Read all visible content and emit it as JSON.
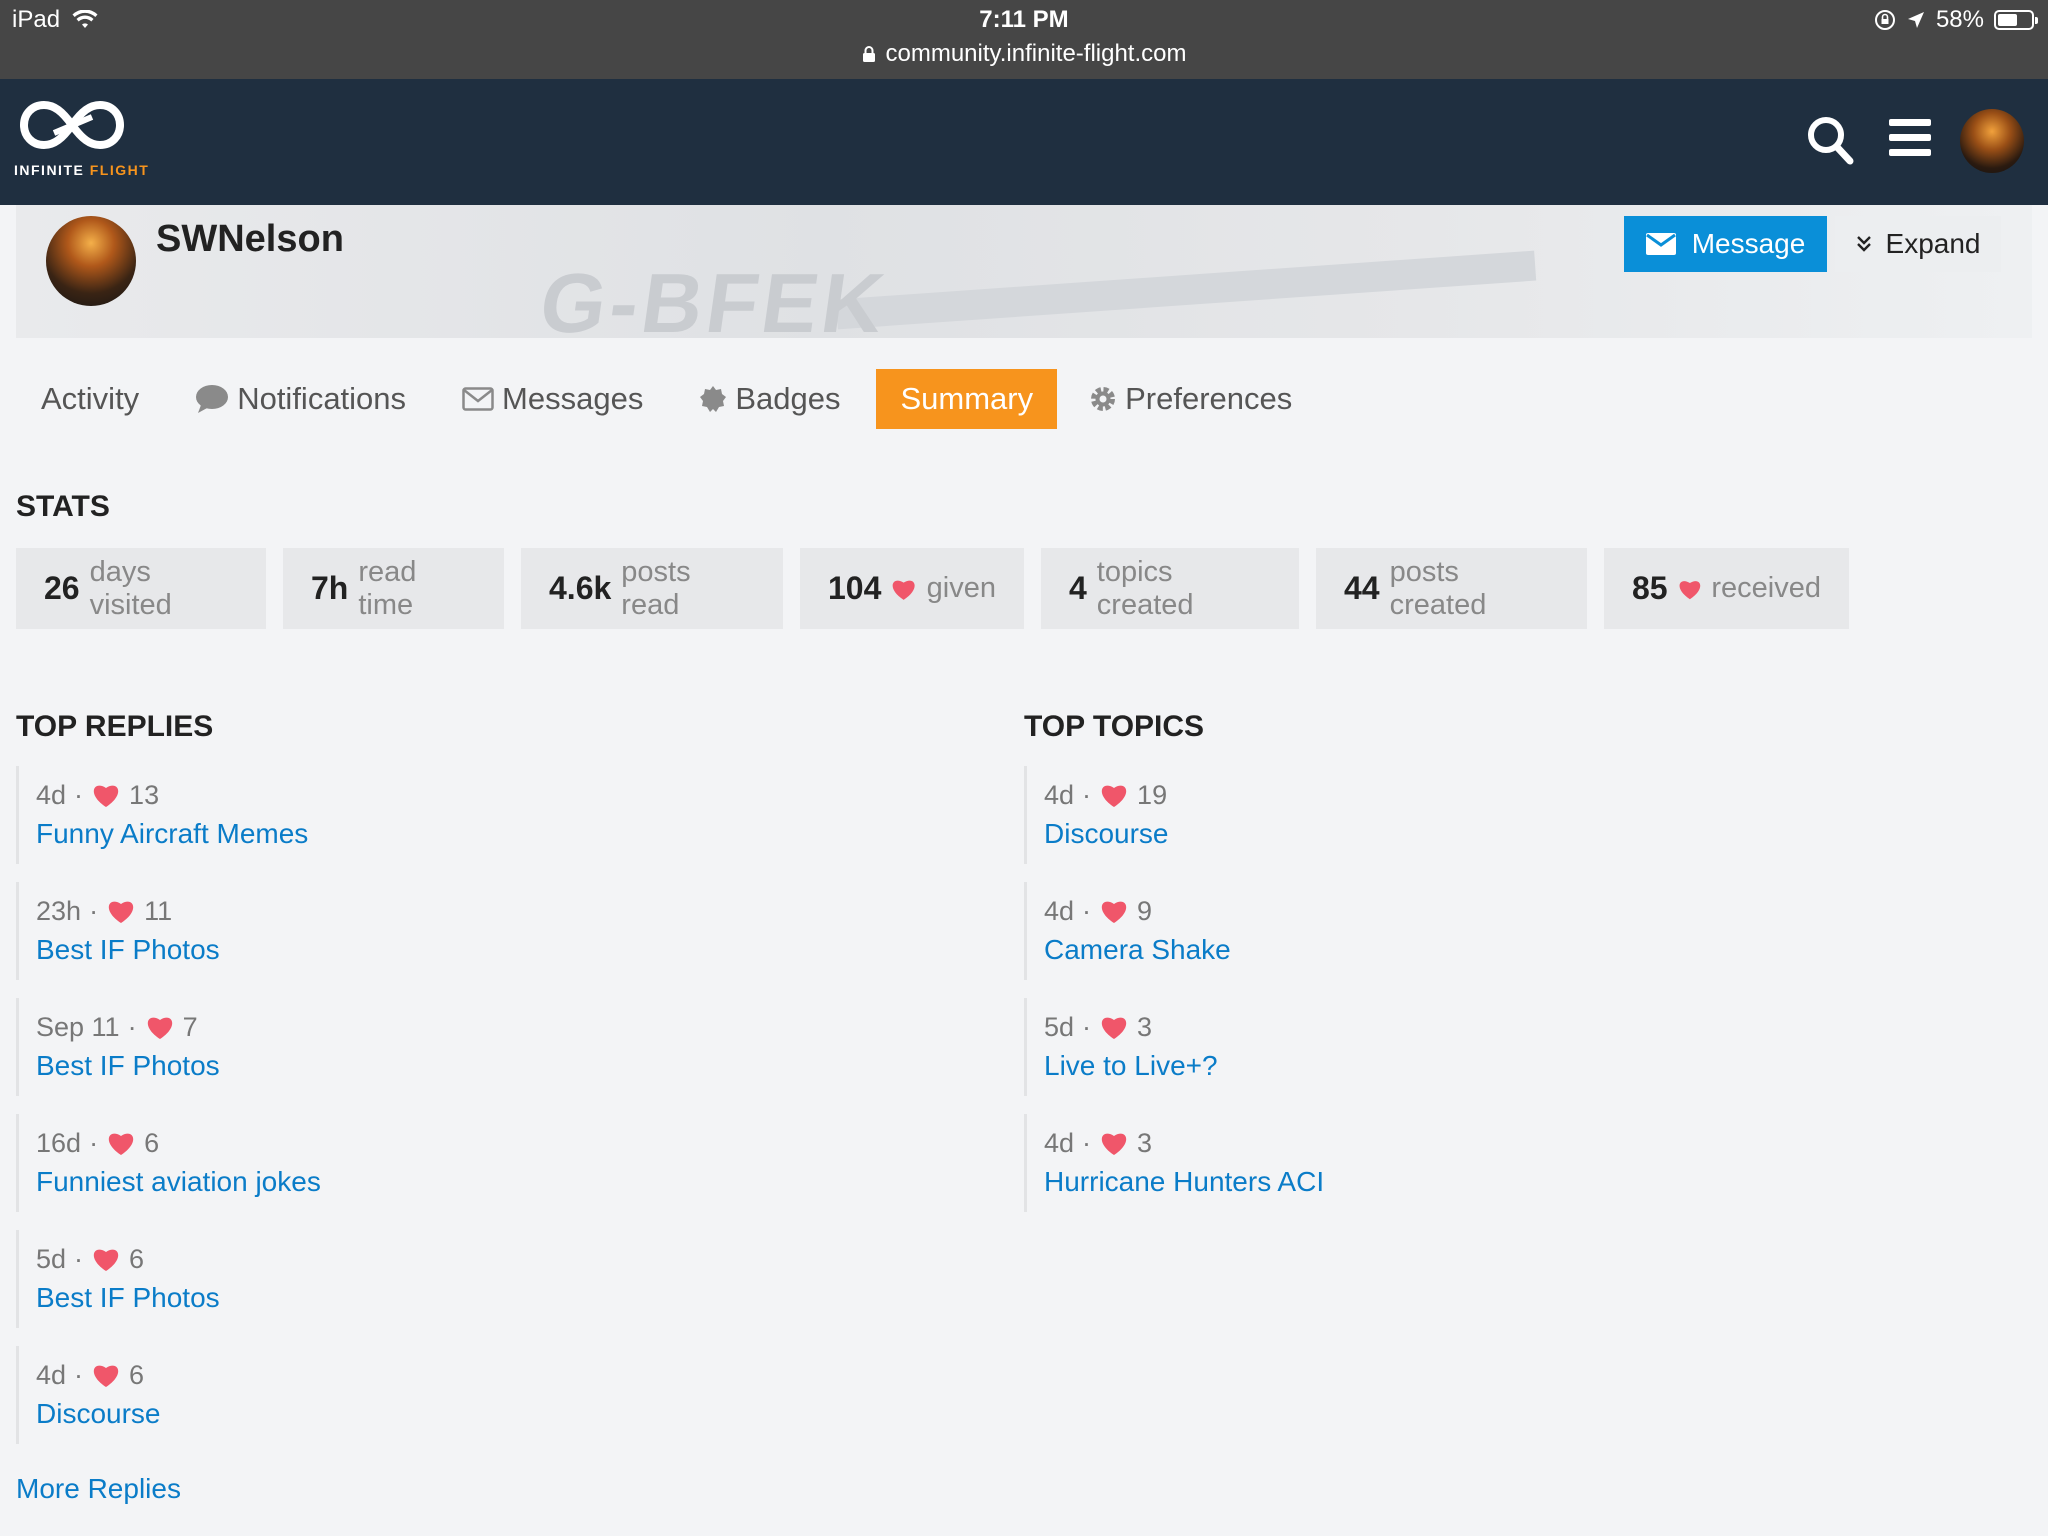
{
  "status_bar": {
    "device": "iPad",
    "time": "7:11 PM",
    "battery": "58%",
    "battery_fraction": 0.58,
    "url": "community.infinite-flight.com"
  },
  "header": {
    "logo_word1": "INFINITE",
    "logo_word2": "FLIGHT"
  },
  "profile": {
    "username": "SWNelson",
    "banner_text": "G-BFEK",
    "message_label": "Message",
    "expand_label": "Expand"
  },
  "tabs": [
    {
      "label": "Activity",
      "active": false
    },
    {
      "label": "Notifications",
      "active": false
    },
    {
      "label": "Messages",
      "active": false
    },
    {
      "label": "Badges",
      "active": false
    },
    {
      "label": "Summary",
      "active": true
    },
    {
      "label": "Preferences",
      "active": false
    }
  ],
  "stats": {
    "title": "STATS",
    "items": [
      {
        "value": "26",
        "label": "days visited",
        "heart": false
      },
      {
        "value": "7h",
        "label": "read time",
        "heart": false
      },
      {
        "value": "4.6k",
        "label": "posts read",
        "heart": false
      },
      {
        "value": "104",
        "label": "given",
        "heart": true
      },
      {
        "value": "4",
        "label": "topics created",
        "heart": false
      },
      {
        "value": "44",
        "label": "posts created",
        "heart": false
      },
      {
        "value": "85",
        "label": "received",
        "heart": true
      }
    ]
  },
  "top_replies": {
    "title": "TOP REPLIES",
    "items": [
      {
        "age": "4d",
        "likes": "13",
        "title": "Funny Aircraft Memes"
      },
      {
        "age": "23h",
        "likes": "11",
        "title": "Best IF Photos"
      },
      {
        "age": "Sep 11",
        "likes": "7",
        "title": "Best IF Photos"
      },
      {
        "age": "16d",
        "likes": "6",
        "title": "Funniest aviation jokes"
      },
      {
        "age": "5d",
        "likes": "6",
        "title": "Best IF Photos"
      },
      {
        "age": "4d",
        "likes": "6",
        "title": "Discourse"
      }
    ],
    "more_label": "More Replies"
  },
  "top_topics": {
    "title": "TOP TOPICS",
    "items": [
      {
        "age": "4d",
        "likes": "19",
        "title": "Discourse"
      },
      {
        "age": "4d",
        "likes": "9",
        "title": "Camera Shake"
      },
      {
        "age": "5d",
        "likes": "3",
        "title": "Live to Live+?"
      },
      {
        "age": "4d",
        "likes": "3",
        "title": "Hurricane Hunters ACI"
      }
    ]
  },
  "colors": {
    "accent": "#f7941d",
    "link": "#0a7cc8",
    "button_primary": "#0a8fd8",
    "header_bg": "#1f2f40",
    "heart": "#f0566a"
  }
}
